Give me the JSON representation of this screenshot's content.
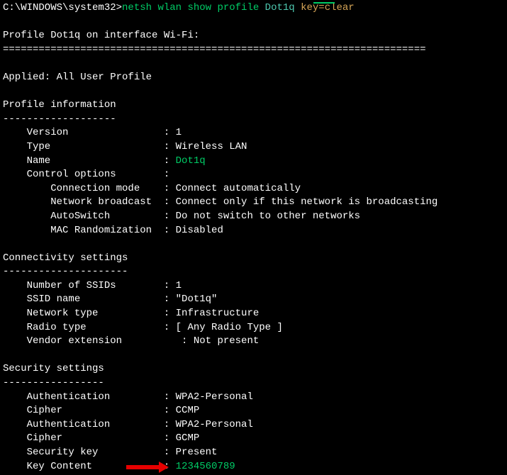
{
  "prompt": {
    "path": "C:\\WINDOWS\\system32>",
    "cmd": "netsh wlan show profile",
    "arg_profile": "Dot1q",
    "arg_key": "key=clear"
  },
  "header": {
    "profile_line": "Profile Dot1q on interface Wi-Fi:",
    "divider": "======================================================================="
  },
  "applied": {
    "label": "Applied: All User Profile"
  },
  "sections": {
    "profile_info": {
      "title": "Profile information",
      "dash": "-------------------",
      "rows": {
        "version": {
          "label": "    Version                : ",
          "value": "1"
        },
        "type": {
          "label": "    Type                   : ",
          "value": "Wireless LAN"
        },
        "name": {
          "label": "    Name                   : ",
          "value": "Dot1q",
          "green": true
        },
        "control": {
          "label": "    Control options        :",
          "value": ""
        },
        "conn_mode": {
          "label": "        Connection mode    : ",
          "value": "Connect automatically"
        },
        "net_broadcast": {
          "label": "        Network broadcast  : ",
          "value": "Connect only if this network is broadcasting"
        },
        "autoswitch": {
          "label": "        AutoSwitch         : ",
          "value": "Do not switch to other networks"
        },
        "mac_rand": {
          "label": "        MAC Randomization  : ",
          "value": "Disabled"
        }
      }
    },
    "connectivity": {
      "title": "Connectivity settings",
      "dash": "---------------------",
      "rows": {
        "num_ssids": {
          "label": "    Number of SSIDs        : ",
          "value": "1"
        },
        "ssid_name": {
          "label": "    SSID name              : ",
          "value": "\"Dot1q\""
        },
        "net_type": {
          "label": "    Network type           : ",
          "value": "Infrastructure"
        },
        "radio_type": {
          "label": "    Radio type             : ",
          "value": "[ Any Radio Type ]"
        },
        "vendor_ext": {
          "label": "    Vendor extension          : ",
          "value": "Not present"
        }
      }
    },
    "security": {
      "title": "Security settings",
      "dash": "-----------------",
      "rows": {
        "auth1": {
          "label": "    Authentication         : ",
          "value": "WPA2-Personal"
        },
        "cipher1": {
          "label": "    Cipher                 : ",
          "value": "CCMP"
        },
        "auth2": {
          "label": "    Authentication         : ",
          "value": "WPA2-Personal"
        },
        "cipher2": {
          "label": "    Cipher                 : ",
          "value": "GCMP"
        },
        "seckey": {
          "label": "    Security key           : ",
          "value": "Present"
        },
        "keycont": {
          "label": "    Key Content            : ",
          "value": "1234560789",
          "green": true,
          "arrow": true
        }
      }
    }
  }
}
